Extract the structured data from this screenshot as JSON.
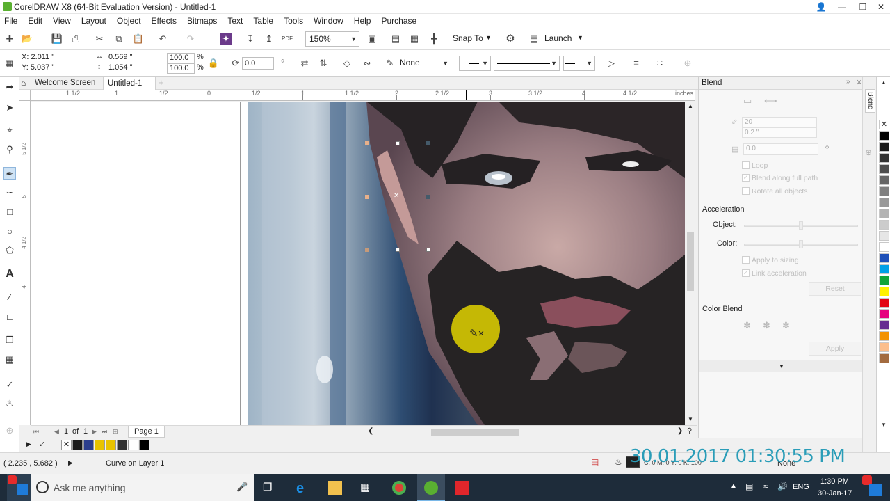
{
  "window": {
    "title": "CorelDRAW X8 (64-Bit Evaluation Version) - Untitled-1"
  },
  "menu": [
    "File",
    "Edit",
    "View",
    "Layout",
    "Object",
    "Effects",
    "Bitmaps",
    "Text",
    "Table",
    "Tools",
    "Window",
    "Help",
    "Purchase"
  ],
  "toolbar": {
    "zoom": "150%",
    "snap_to": "Snap To",
    "launch": "Launch"
  },
  "propbar": {
    "x": "X: 2.011 \"",
    "y": "Y: 5.037 \"",
    "w": "0.569 \"",
    "h": "1.054 \"",
    "scale_x": "100.0",
    "scale_y": "100.0",
    "pct": "%",
    "angle": "0.0",
    "outline": "None"
  },
  "tabs": {
    "welcome": "Welcome Screen",
    "doc": "Untitled-1"
  },
  "ruler": {
    "labels": [
      "1 1/2",
      "1",
      "1/2",
      "0",
      "1/2",
      "1",
      "1 1/2",
      "2",
      "2 1/2",
      "3",
      "3 1/2",
      "4",
      "4 1/2"
    ],
    "unit": "inches",
    "vlabels": [
      "5 1/2",
      "5",
      "4 1/2",
      "4"
    ]
  },
  "docker": {
    "title": "Blend",
    "steps": "20",
    "spacing": "0.2 \"",
    "rotation": "0.0",
    "loop": "Loop",
    "blend_along": "Blend along full path",
    "rotate_all": "Rotate all objects",
    "acceleration": "Acceleration",
    "object_label": "Object:",
    "color_label": "Color:",
    "apply_sizing": "Apply to sizing",
    "link_accel": "Link acceleration",
    "reset": "Reset",
    "color_blend": "Color Blend",
    "apply": "Apply"
  },
  "pagenav": {
    "current": "1",
    "of": "of",
    "total": "1",
    "page": "Page 1"
  },
  "status": {
    "coords": "( 2.235 , 5.682 )",
    "info": "Curve on Layer 1",
    "fill": "None",
    "outline": "C: 0 M: 0 Y: 0 K: 100"
  },
  "timestamp": "30.01.2017 01:30:55 PM",
  "taskbar": {
    "search": "Ask me anything",
    "lang": "ENG",
    "time": "1:30 PM",
    "date": "30-Jan-17"
  },
  "colors": {
    "accent": "#2a9db8",
    "node": "#e0a070",
    "cursor_highlight": "#e2d200"
  }
}
